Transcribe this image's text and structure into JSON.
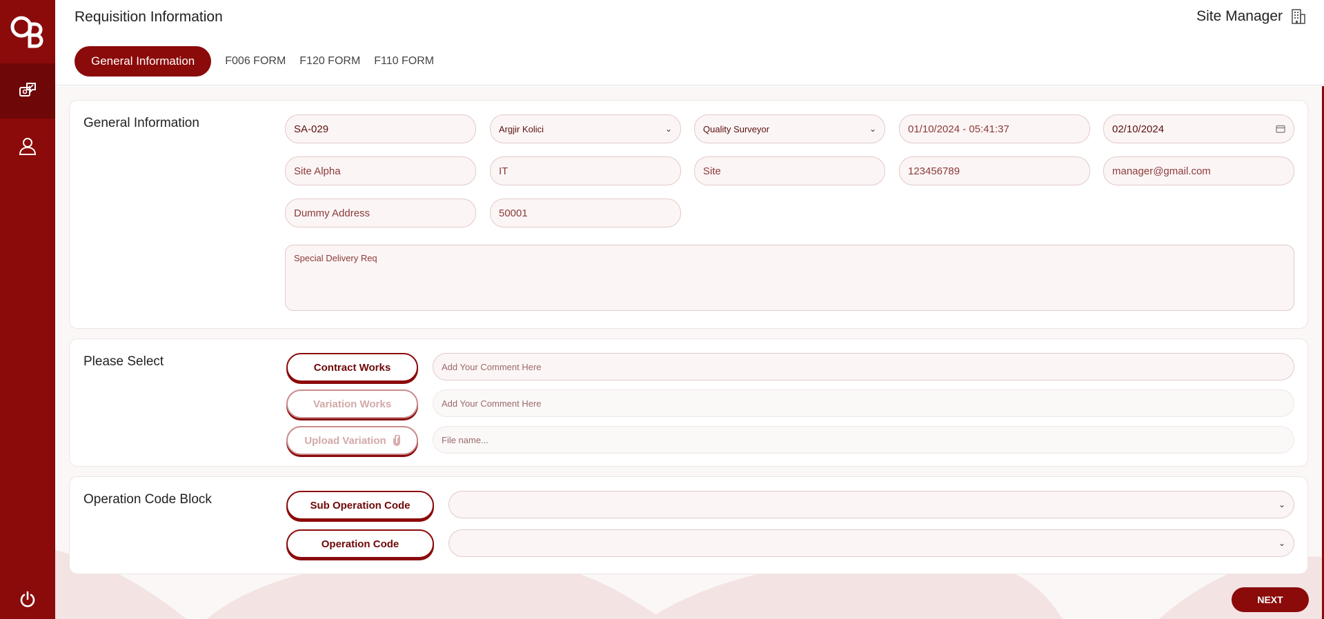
{
  "app": {
    "logo_text": "OB",
    "page_title": "Requisition Information",
    "user_role": "Site Manager"
  },
  "tabs": [
    {
      "label": "General Information",
      "active": true
    },
    {
      "label": "F006 FORM",
      "active": false
    },
    {
      "label": "F120 FORM",
      "active": false
    },
    {
      "label": "F110 FORM",
      "active": false
    }
  ],
  "general": {
    "title": "General Information",
    "requisition_id": "SA-029",
    "person_select": "Argjir Kolici",
    "role_select": "Quality Surveyor",
    "created_datetime": "01/10/2024 - 05:41:37",
    "required_date": "02/10/2024",
    "site_name": "Site Alpha",
    "department": "IT",
    "site_type": "Site",
    "phone": "123456789",
    "email": "manager@gmail.com",
    "address": "Dummy Address",
    "postcode": "50001",
    "special_delivery_placeholder": "Special Delivery Req"
  },
  "please_select": {
    "title": "Please Select",
    "contract_works_label": "Contract Works",
    "contract_comment_placeholder": "Add Your Comment Here",
    "variation_works_label": "Variation Works",
    "variation_comment_placeholder": "Add Your Comment Here",
    "upload_variation_label": "Upload Variation",
    "file_name_placeholder": "File name..."
  },
  "operation": {
    "title": "Operation Code Block",
    "sub_operation_label": "Sub Operation Code",
    "sub_operation_value": "",
    "operation_label": "Operation Code",
    "operation_value": ""
  },
  "footer": {
    "next_label": "NEXT"
  },
  "colors": {
    "brand": "#8b0a0a",
    "brand_dark": "#6e0707",
    "field_bg": "#fcf5f5",
    "field_border": "#e3c9c9"
  }
}
